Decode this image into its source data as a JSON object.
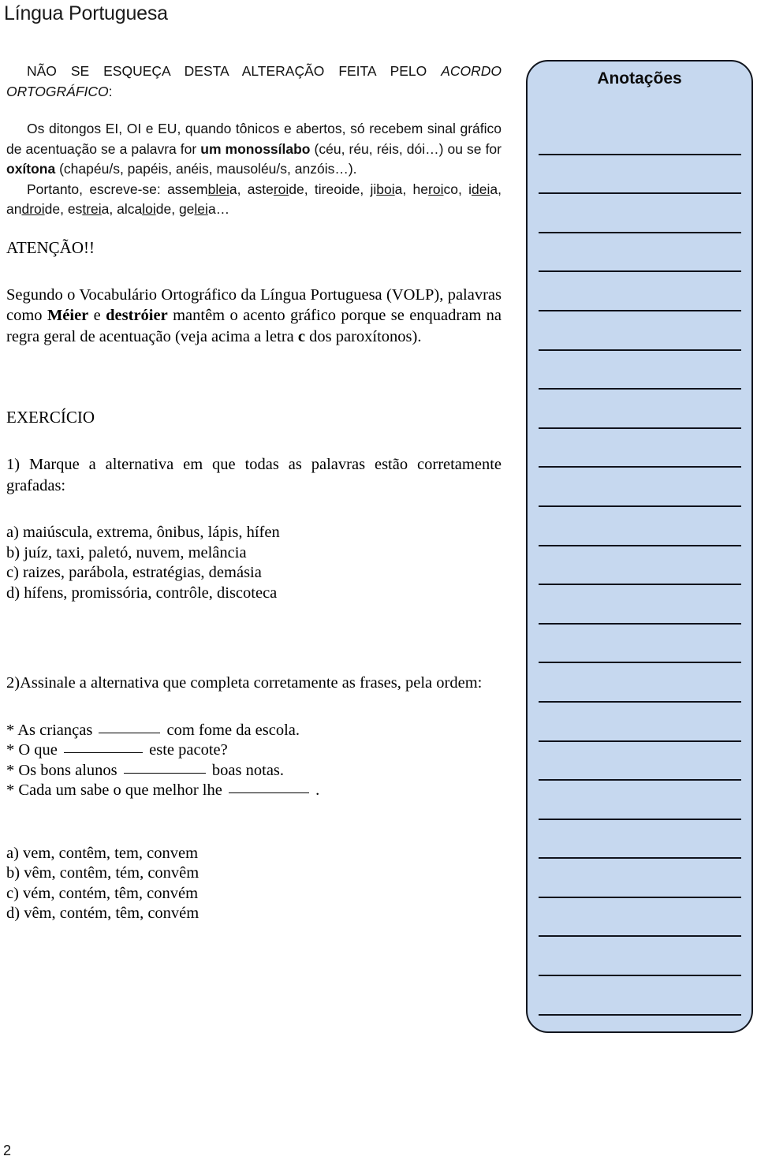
{
  "header": {
    "title": "Língua Portuguesa"
  },
  "notice": {
    "line1_plain": "NÃO SE ESQUEÇA DESTA ALTERAÇÃO FEITA PELO ",
    "line1_italic": "ACORDO ORTOGRÁFICO",
    "line1_colon": ":"
  },
  "rule": {
    "p1_a": "Os ditongos EI, OI e EU, quando tônicos e abertos, só recebem sinal gráfico de acentuação se a palavra for ",
    "p1_bold1": "um monossílabo",
    "p1_b": " (céu, réu, réis, dói…) ou se for ",
    "p1_bold2": "oxítona",
    "p1_c": " (chapéu/s, papéis, anéis, mausoléu/s, anzóis…).",
    "p2_intro": "Portanto, escreve-se: assem",
    "p2_words": [
      {
        "pre": "assem",
        "u": "blei",
        "post": "a, "
      },
      {
        "pre": "aste",
        "u": "roi",
        "post": "de, "
      },
      {
        "pre": "tireoide",
        "u": "",
        "post": ", "
      },
      {
        "pre": "ji",
        "u": "boi",
        "post": "a, "
      },
      {
        "pre": "he",
        "u": "roi",
        "post": "co, "
      },
      {
        "pre": "i",
        "u": "dei",
        "post": "a, "
      },
      {
        "pre": "an",
        "u": "droi",
        "post": "de, "
      },
      {
        "pre": "es",
        "u": "trei",
        "post": "a, "
      },
      {
        "pre": "alca",
        "u": "loi",
        "post": "de, "
      },
      {
        "pre": "ge",
        "u": "lei",
        "post": "a…"
      }
    ]
  },
  "attention": {
    "heading": "ATENÇÃO!!",
    "body_a": "Segundo o Vocabulário Ortográfico da Língua Portuguesa (VOLP), palavras como ",
    "body_bold1": "Méier",
    "body_b": " e ",
    "body_bold2": "destróier",
    "body_c": " mantêm o acento gráfico porque se enquadram na regra geral de acentuação (veja acima a letra ",
    "body_bold3": "c",
    "body_d": " dos paroxítonos)."
  },
  "exercise": {
    "heading": "EXERCÍCIO",
    "q1": {
      "statement": "1) Marque a alternativa em que todas as palavras estão corretamente grafadas:",
      "options": [
        "a) maiúscula, extrema, ônibus, lápis, hífen",
        "b) juíz, taxi, paletó, nuvem, melância",
        "c) raizes, parábola, estratégias, demásia",
        "d) hífens, promissória, contrôle, discoteca"
      ]
    },
    "q2": {
      "statement": "2)Assinale a alternativa que completa corretamente as frases, pela ordem:",
      "sentences": [
        {
          "before": "* As crianças",
          "blank_width": 78,
          "after": "com fome da escola."
        },
        {
          "before": "* O que",
          "blank_width": 100,
          "after": "este pacote?"
        },
        {
          "before": "* Os bons alunos",
          "blank_width": 104,
          "after": "boas notas."
        },
        {
          "before": "* Cada um sabe o que melhor lhe",
          "blank_width": 102,
          "after": "."
        }
      ],
      "options": [
        "a) vem, contêm, tem, convem",
        "b) vêm, contêm, tém, convêm",
        "c) vém, contém, têm, convém",
        "d) vêm, contém, têm, convém"
      ]
    }
  },
  "notes": {
    "title": "Anotações",
    "line_count": 24
  },
  "footer": {
    "page_number": "2"
  },
  "colors": {
    "notes_fill": "#c6d8ef",
    "notes_border": "#11151d",
    "text": "#000000"
  }
}
